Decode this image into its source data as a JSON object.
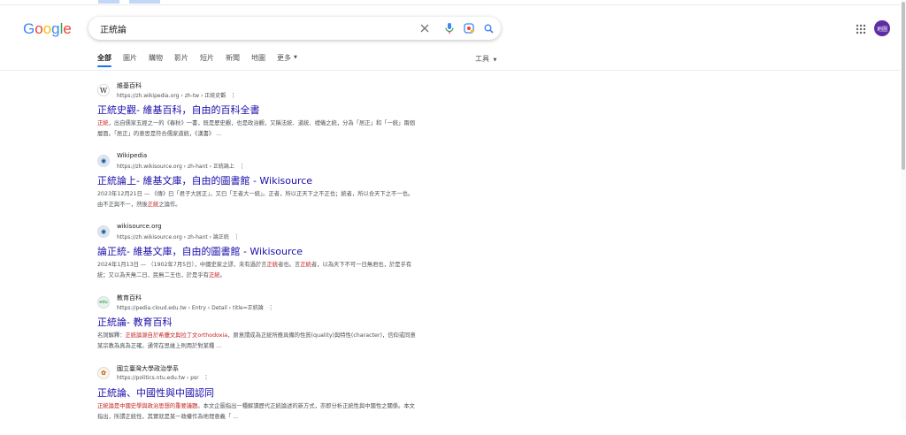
{
  "search": {
    "query": "正統論"
  },
  "header": {
    "avatar_text": "地圖"
  },
  "tabs": [
    "全部",
    "圖片",
    "購物",
    "影片",
    "短片",
    "新聞",
    "地圖",
    "更多"
  ],
  "tools_label": "工具",
  "colors": {
    "link": "#1a0dab",
    "accent": "#1a73e8",
    "highlight": "#c5221f",
    "avatar": "#5e2ca5"
  },
  "results": [
    {
      "favicon": "W",
      "site": "維基百科",
      "url": "https://zh.wikipedia.org › zh-tw › 正統史觀",
      "title": "正統史觀- 維基百科，自由的百科全書",
      "snippet_parts": [
        {
          "t": "正統",
          "h": true
        },
        {
          "t": "，出自儒家五經之一的《春秋》一書，既是歷史觀，也是政治觀，又稱法統、道統、禮儀之統，分為「居正」和「一統」兩個層面。「居正」的意思是符合儒家道統，《漢書》 ...",
          "h": false
        }
      ]
    },
    {
      "favicon": "◉",
      "site": "Wikipedia",
      "url": "https://zh.wikisource.org › zh-hant › 正統論上",
      "title": "正統論上- 維基文庫，自由的圖書館 - Wikisource",
      "snippet_parts": [
        {
          "t": "2023年12月21日 — 《傳》曰「君子大居正」，又曰「王者大一統」。正者，所以正天下之不正也；統者，所以合天下之不一也。由不正與不一，然後",
          "h": false
        },
        {
          "t": "正統",
          "h": true
        },
        {
          "t": "之論作。",
          "h": false
        }
      ]
    },
    {
      "favicon": "◉",
      "site": "wikisource.org",
      "url": "https://zh.wikisource.org › zh-hant › 論正統",
      "title": "論正統- 維基文庫，自由的圖書館 - Wikisource",
      "snippet_parts": [
        {
          "t": "2024年1月13日 — （1902年7月5日），中國史家之謬，未有過於言",
          "h": false
        },
        {
          "t": "正統",
          "h": true
        },
        {
          "t": "者也。言",
          "h": false
        },
        {
          "t": "正統",
          "h": true
        },
        {
          "t": "者，以為天下不可一日無君也，於是乎有統；又以為天無二日、民無二王也，於是乎有",
          "h": false
        },
        {
          "t": "正統",
          "h": true
        },
        {
          "t": "。",
          "h": false
        }
      ]
    },
    {
      "favicon": "edu",
      "site": "教育百科",
      "url": "https://pedia.cloud.edu.tw › Entry › Detail › title=正統論",
      "title": "正統論- 教育百科",
      "snippet_parts": [
        {
          "t": "名詞解釋：",
          "h": false
        },
        {
          "t": "正統論源自於希臘文與拉丁文orthodoxia",
          "h": true
        },
        {
          "t": "，原意謂成為正統所應具備的性質(quality)與特性(character)，信仰或同意某宗教為真為正確。通常在思維上則用於對某種 ...",
          "h": false
        }
      ]
    },
    {
      "favicon": "✿",
      "site": "國立臺灣大學政治學系",
      "url": "https://politics.ntu.edu.tw › psr",
      "title": "正統論、中國性與中國認同",
      "snippet_parts": [
        {
          "t": "正統論是中國史學與政治思想的重要議題",
          "h": true
        },
        {
          "t": "。本文企圖指出一種解讀歷代正統論述的新方式，亦即分析正統性與中國性之關係。本文指出，所謂正統性，其實就是某一政權作為地理意義「 ...",
          "h": false
        }
      ]
    }
  ]
}
